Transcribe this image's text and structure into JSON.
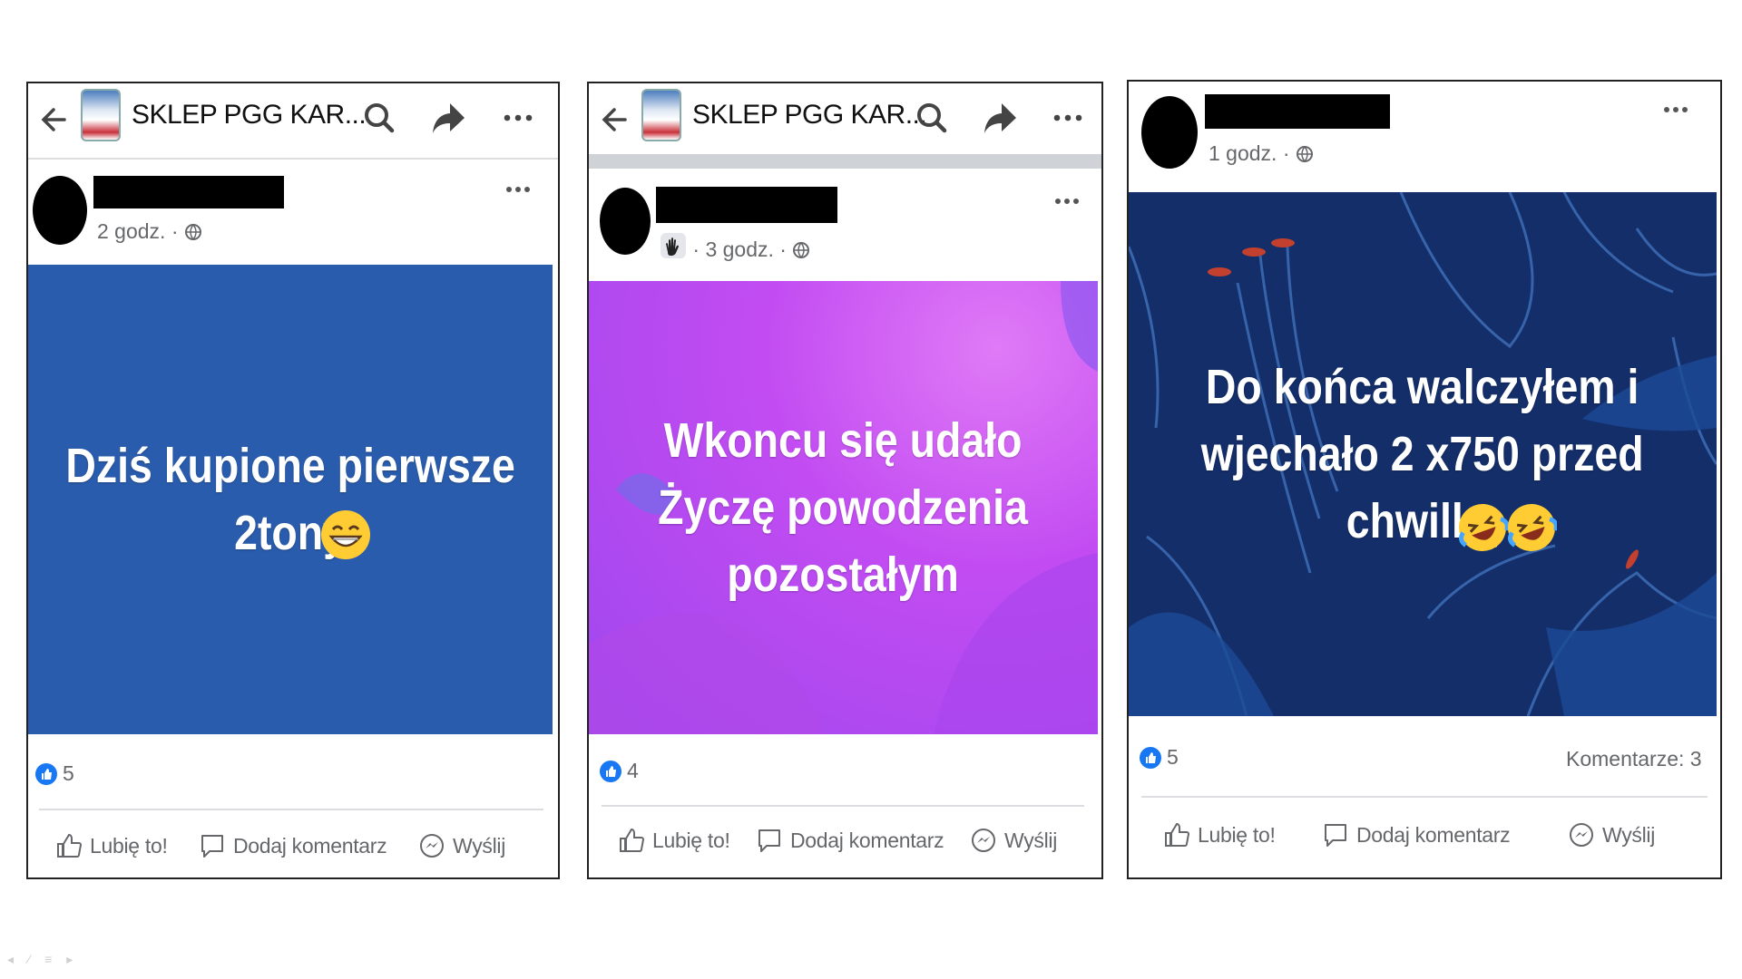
{
  "posts": [
    {
      "page_name": "SKLEP PGG KAR...",
      "time": "2 godz.",
      "text": "Dziś kupione pierwsze\n2tony",
      "reactions": "5",
      "actions": {
        "like": "Lubię to!",
        "comment": "Dodaj komentarz",
        "send": "Wyślij"
      }
    },
    {
      "page_name": "SKLEP PGG KAR...",
      "time": "3 godz.",
      "text": "Wkoncu się udało\nŻyczę  powodzenia\npozostałym",
      "reactions": "4",
      "actions": {
        "like": "Lubię to!",
        "comment": "Dodaj komentarz",
        "send": "Wyślij"
      }
    },
    {
      "time": "1 godz.",
      "text": "Do końca walczyłem i\nwjechało 2 x750 przed\nchwilką",
      "reactions": "5",
      "comments": "Komentarze: 3",
      "actions": {
        "like": "Lubię to!",
        "comment": "Dodaj komentarz",
        "send": "Wyślij"
      }
    }
  ],
  "colors": {
    "post1_bg": "#2a5cad",
    "post2_bg": "#c24cf2",
    "post3_bg": "#142e6a",
    "like_blue": "#1877f2"
  },
  "icons": [
    "back-arrow-icon",
    "search-icon",
    "share-icon",
    "more-icon",
    "globe-icon",
    "wave-hand-icon",
    "like-icon",
    "comment-icon",
    "messenger-icon",
    "grinning-emoji",
    "laughing-crying-emoji"
  ]
}
